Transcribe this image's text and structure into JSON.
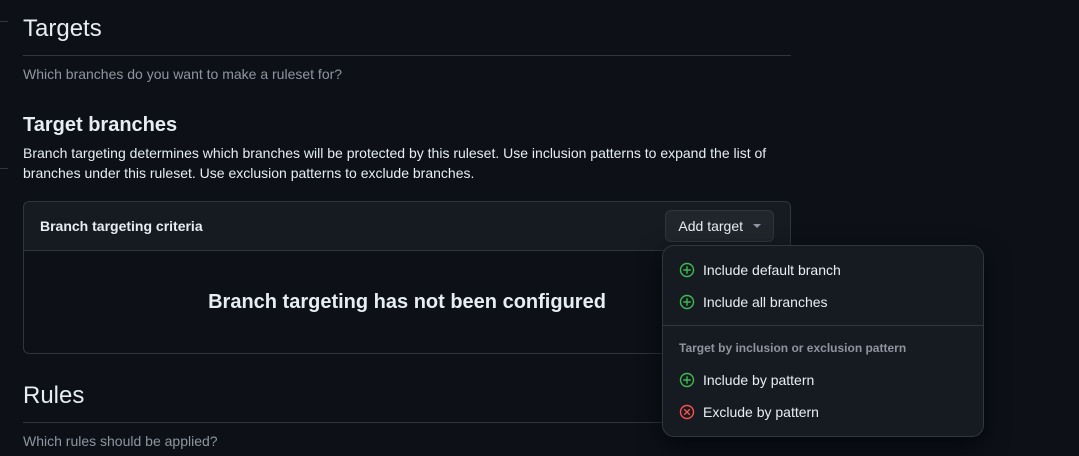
{
  "targets": {
    "title": "Targets",
    "description": "Which branches do you want to make a ruleset for?"
  },
  "target_branches": {
    "title": "Target branches",
    "description": "Branch targeting determines which branches will be protected by this ruleset. Use inclusion patterns to expand the list of branches under this ruleset. Use exclusion patterns to exclude branches.",
    "criteria_title": "Branch targeting criteria",
    "add_target_label": "Add target",
    "empty_message": "Branch targeting has not been configured"
  },
  "rules": {
    "title": "Rules",
    "description": "Which rules should be applied?"
  },
  "menu": {
    "items": [
      {
        "label": "Include default branch",
        "icon": "plus-circle-icon"
      },
      {
        "label": "Include all branches",
        "icon": "plus-circle-icon"
      }
    ],
    "group_label": "Target by inclusion or exclusion pattern",
    "pattern_items": [
      {
        "label": "Include by pattern",
        "icon": "plus-circle-icon"
      },
      {
        "label": "Exclude by pattern",
        "icon": "x-circle-icon"
      }
    ]
  },
  "colors": {
    "background": "#0d1117",
    "include_green": "#3fb950",
    "exclude_red": "#f85149"
  }
}
